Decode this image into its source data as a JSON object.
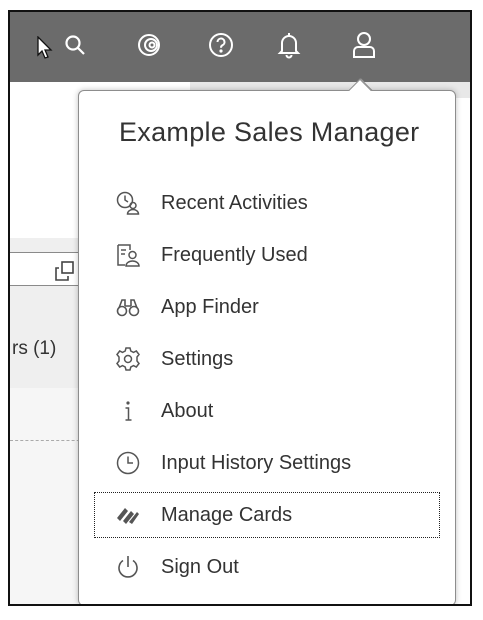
{
  "shellbar": {
    "icons": [
      "cursor-icon",
      "search-icon",
      "copilot-icon",
      "help-icon",
      "notifications-icon",
      "user-icon"
    ]
  },
  "background": {
    "partial_label": "rs (1)"
  },
  "user_menu": {
    "title": "Example Sales Manager",
    "items": [
      {
        "label": "Recent Activities",
        "icon": "recent-activities-icon"
      },
      {
        "label": "Frequently Used",
        "icon": "frequently-used-icon"
      },
      {
        "label": "App Finder",
        "icon": "binoculars-icon"
      },
      {
        "label": "Settings",
        "icon": "gear-icon"
      },
      {
        "label": "About",
        "icon": "info-icon"
      },
      {
        "label": "Input History Settings",
        "icon": "clock-icon"
      },
      {
        "label": "Manage Cards",
        "icon": "cards-icon",
        "focused": true
      },
      {
        "label": "Sign Out",
        "icon": "power-icon"
      }
    ]
  },
  "colors": {
    "shellbar_bg": "#6b6b6b",
    "text": "#333333",
    "popover_border": "#8d8d8d"
  }
}
